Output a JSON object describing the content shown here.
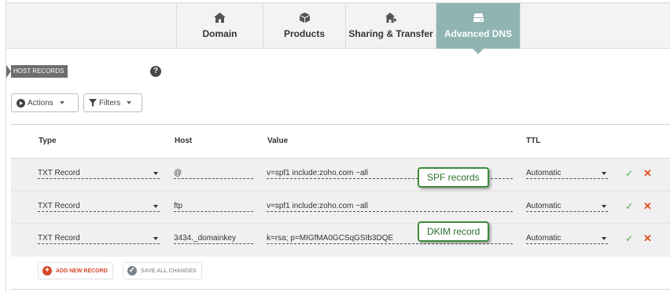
{
  "tabs": [
    {
      "label": "Domain",
      "icon": "house-icon",
      "active": false
    },
    {
      "label": "Products",
      "icon": "box-icon",
      "active": false
    },
    {
      "label": "Sharing & Transfer",
      "icon": "house-arrow-icon",
      "active": false
    },
    {
      "label": "Advanced DNS",
      "icon": "server-icon",
      "active": true
    }
  ],
  "section": {
    "label": "HOST RECORDS",
    "help": "?"
  },
  "toolbar": {
    "actions_label": "Actions",
    "filters_label": "Filters"
  },
  "table": {
    "columns": {
      "type": "Type",
      "host": "Host",
      "value": "Value",
      "ttl": "TTL"
    },
    "rows": [
      {
        "type": "TXT Record",
        "host": "@",
        "value": "v=spf1 include:zoho.com ~all",
        "ttl": "Automatic"
      },
      {
        "type": "TXT Record",
        "host": "ftp",
        "value": "v=spf1 include:zoho.com ~all",
        "ttl": "Automatic"
      },
      {
        "type": "TXT Record",
        "host": "3434._domainkey",
        "value": "k=rsa; p=MIGfMA0GCSqGSIb3DQE",
        "ttl": "Automatic"
      }
    ]
  },
  "callouts": {
    "spf": "SPF records",
    "dkim": "DKIM record"
  },
  "footer": {
    "add_label": "ADD NEW RECORD",
    "save_label": "SAVE ALL CHANGES"
  },
  "colors": {
    "active_tab": "#8fb4b2",
    "check": "#7dbf7a",
    "delete": "#e2501a",
    "add": "#d4482a",
    "callout_border": "#3d8a3b"
  }
}
